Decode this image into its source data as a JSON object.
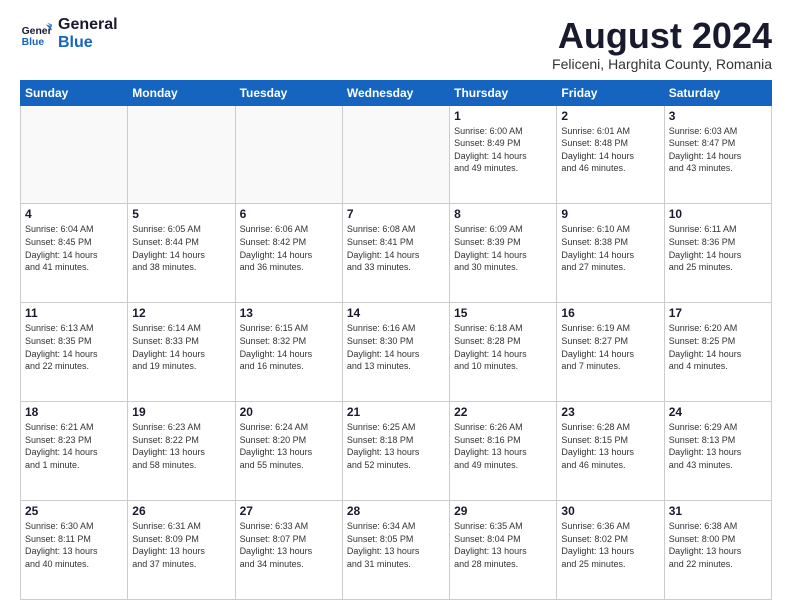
{
  "header": {
    "logo_line1": "General",
    "logo_line2": "Blue",
    "main_title": "August 2024",
    "subtitle": "Feliceni, Harghita County, Romania"
  },
  "calendar": {
    "days_of_week": [
      "Sunday",
      "Monday",
      "Tuesday",
      "Wednesday",
      "Thursday",
      "Friday",
      "Saturday"
    ],
    "weeks": [
      [
        {
          "day": "",
          "info": ""
        },
        {
          "day": "",
          "info": ""
        },
        {
          "day": "",
          "info": ""
        },
        {
          "day": "",
          "info": ""
        },
        {
          "day": "1",
          "info": "Sunrise: 6:00 AM\nSunset: 8:49 PM\nDaylight: 14 hours\nand 49 minutes."
        },
        {
          "day": "2",
          "info": "Sunrise: 6:01 AM\nSunset: 8:48 PM\nDaylight: 14 hours\nand 46 minutes."
        },
        {
          "day": "3",
          "info": "Sunrise: 6:03 AM\nSunset: 8:47 PM\nDaylight: 14 hours\nand 43 minutes."
        }
      ],
      [
        {
          "day": "4",
          "info": "Sunrise: 6:04 AM\nSunset: 8:45 PM\nDaylight: 14 hours\nand 41 minutes."
        },
        {
          "day": "5",
          "info": "Sunrise: 6:05 AM\nSunset: 8:44 PM\nDaylight: 14 hours\nand 38 minutes."
        },
        {
          "day": "6",
          "info": "Sunrise: 6:06 AM\nSunset: 8:42 PM\nDaylight: 14 hours\nand 36 minutes."
        },
        {
          "day": "7",
          "info": "Sunrise: 6:08 AM\nSunset: 8:41 PM\nDaylight: 14 hours\nand 33 minutes."
        },
        {
          "day": "8",
          "info": "Sunrise: 6:09 AM\nSunset: 8:39 PM\nDaylight: 14 hours\nand 30 minutes."
        },
        {
          "day": "9",
          "info": "Sunrise: 6:10 AM\nSunset: 8:38 PM\nDaylight: 14 hours\nand 27 minutes."
        },
        {
          "day": "10",
          "info": "Sunrise: 6:11 AM\nSunset: 8:36 PM\nDaylight: 14 hours\nand 25 minutes."
        }
      ],
      [
        {
          "day": "11",
          "info": "Sunrise: 6:13 AM\nSunset: 8:35 PM\nDaylight: 14 hours\nand 22 minutes."
        },
        {
          "day": "12",
          "info": "Sunrise: 6:14 AM\nSunset: 8:33 PM\nDaylight: 14 hours\nand 19 minutes."
        },
        {
          "day": "13",
          "info": "Sunrise: 6:15 AM\nSunset: 8:32 PM\nDaylight: 14 hours\nand 16 minutes."
        },
        {
          "day": "14",
          "info": "Sunrise: 6:16 AM\nSunset: 8:30 PM\nDaylight: 14 hours\nand 13 minutes."
        },
        {
          "day": "15",
          "info": "Sunrise: 6:18 AM\nSunset: 8:28 PM\nDaylight: 14 hours\nand 10 minutes."
        },
        {
          "day": "16",
          "info": "Sunrise: 6:19 AM\nSunset: 8:27 PM\nDaylight: 14 hours\nand 7 minutes."
        },
        {
          "day": "17",
          "info": "Sunrise: 6:20 AM\nSunset: 8:25 PM\nDaylight: 14 hours\nand 4 minutes."
        }
      ],
      [
        {
          "day": "18",
          "info": "Sunrise: 6:21 AM\nSunset: 8:23 PM\nDaylight: 14 hours\nand 1 minute."
        },
        {
          "day": "19",
          "info": "Sunrise: 6:23 AM\nSunset: 8:22 PM\nDaylight: 13 hours\nand 58 minutes."
        },
        {
          "day": "20",
          "info": "Sunrise: 6:24 AM\nSunset: 8:20 PM\nDaylight: 13 hours\nand 55 minutes."
        },
        {
          "day": "21",
          "info": "Sunrise: 6:25 AM\nSunset: 8:18 PM\nDaylight: 13 hours\nand 52 minutes."
        },
        {
          "day": "22",
          "info": "Sunrise: 6:26 AM\nSunset: 8:16 PM\nDaylight: 13 hours\nand 49 minutes."
        },
        {
          "day": "23",
          "info": "Sunrise: 6:28 AM\nSunset: 8:15 PM\nDaylight: 13 hours\nand 46 minutes."
        },
        {
          "day": "24",
          "info": "Sunrise: 6:29 AM\nSunset: 8:13 PM\nDaylight: 13 hours\nand 43 minutes."
        }
      ],
      [
        {
          "day": "25",
          "info": "Sunrise: 6:30 AM\nSunset: 8:11 PM\nDaylight: 13 hours\nand 40 minutes."
        },
        {
          "day": "26",
          "info": "Sunrise: 6:31 AM\nSunset: 8:09 PM\nDaylight: 13 hours\nand 37 minutes."
        },
        {
          "day": "27",
          "info": "Sunrise: 6:33 AM\nSunset: 8:07 PM\nDaylight: 13 hours\nand 34 minutes."
        },
        {
          "day": "28",
          "info": "Sunrise: 6:34 AM\nSunset: 8:05 PM\nDaylight: 13 hours\nand 31 minutes."
        },
        {
          "day": "29",
          "info": "Sunrise: 6:35 AM\nSunset: 8:04 PM\nDaylight: 13 hours\nand 28 minutes."
        },
        {
          "day": "30",
          "info": "Sunrise: 6:36 AM\nSunset: 8:02 PM\nDaylight: 13 hours\nand 25 minutes."
        },
        {
          "day": "31",
          "info": "Sunrise: 6:38 AM\nSunset: 8:00 PM\nDaylight: 13 hours\nand 22 minutes."
        }
      ]
    ]
  }
}
